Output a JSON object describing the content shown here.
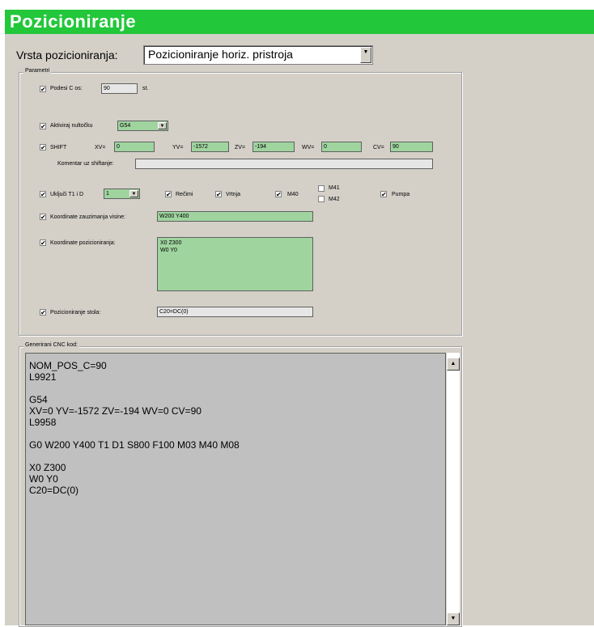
{
  "window": {
    "title": "Pozicioniranje"
  },
  "vrsta": {
    "label": "Vrsta pozicioniranja:",
    "value": "Pozicioniranje horiz. pristroja"
  },
  "params": {
    "group_title": "Parametri",
    "podesi_c": {
      "label": "Podesi C os:",
      "value": "90",
      "unit": "st.",
      "checked": true
    },
    "aktiviraj": {
      "label": "Aktiviraj nultočku",
      "value": "G54",
      "checked": true
    },
    "shift": {
      "label": "SHIFT",
      "checked": true,
      "xv": {
        "label": "XV=",
        "value": "0"
      },
      "yv": {
        "label": "YV=",
        "value": "-1572"
      },
      "zv": {
        "label": "ZV=",
        "value": "-194"
      },
      "wv": {
        "label": "WV=",
        "value": "0"
      },
      "cv": {
        "label": "CV=",
        "value": "90"
      }
    },
    "komentar": {
      "label": "Komentar uz shiftanje:",
      "value": ""
    },
    "ukljuci": {
      "label": "Uključi T1 i D",
      "value": "1",
      "checked": true
    },
    "recni": {
      "label": "Rečimi",
      "checked": true
    },
    "vrtnja": {
      "label": "Vrtnja",
      "checked": true
    },
    "m40": {
      "label": "M40",
      "checked": true
    },
    "m41": {
      "label": "M41",
      "checked": false
    },
    "m42": {
      "label": "M42",
      "checked": false
    },
    "pumpa": {
      "label": "Pumpa",
      "checked": true
    },
    "koord_zauzimanja": {
      "label": "Koordinate zauzimanja visine:",
      "value": "W200 Y400",
      "checked": true
    },
    "koord_pozicioniranja": {
      "label": "Koordinate pozicioniranja:",
      "lines": [
        "X0 Z300",
        "W0 Y0"
      ],
      "checked": true
    },
    "poz_stola": {
      "label": "Pozicioniranje stola:",
      "value": "C20=DC(0)",
      "checked": true
    }
  },
  "cnc": {
    "group_title": "Generirani CNC kod:",
    "lines": [
      "NOM_POS_C=90",
      "L9921",
      "",
      "G54",
      "XV=0 YV=-1572 ZV=-194 WV=0 CV=90",
      "L9958",
      "",
      "G0 W200 Y400 T1 D1 S800 F100 M03 M40 M08",
      "",
      "X0 Z300",
      "W0 Y0",
      "C20=DC(0)"
    ]
  },
  "icons": {
    "checkmark": "✔",
    "dropdown": "▼",
    "scroll_up": "▲",
    "scroll_down": "▼"
  },
  "colors": {
    "title_bg": "#22c73a",
    "field_bg": "#9fd49f",
    "panel_bg": "#d4d0c8"
  }
}
